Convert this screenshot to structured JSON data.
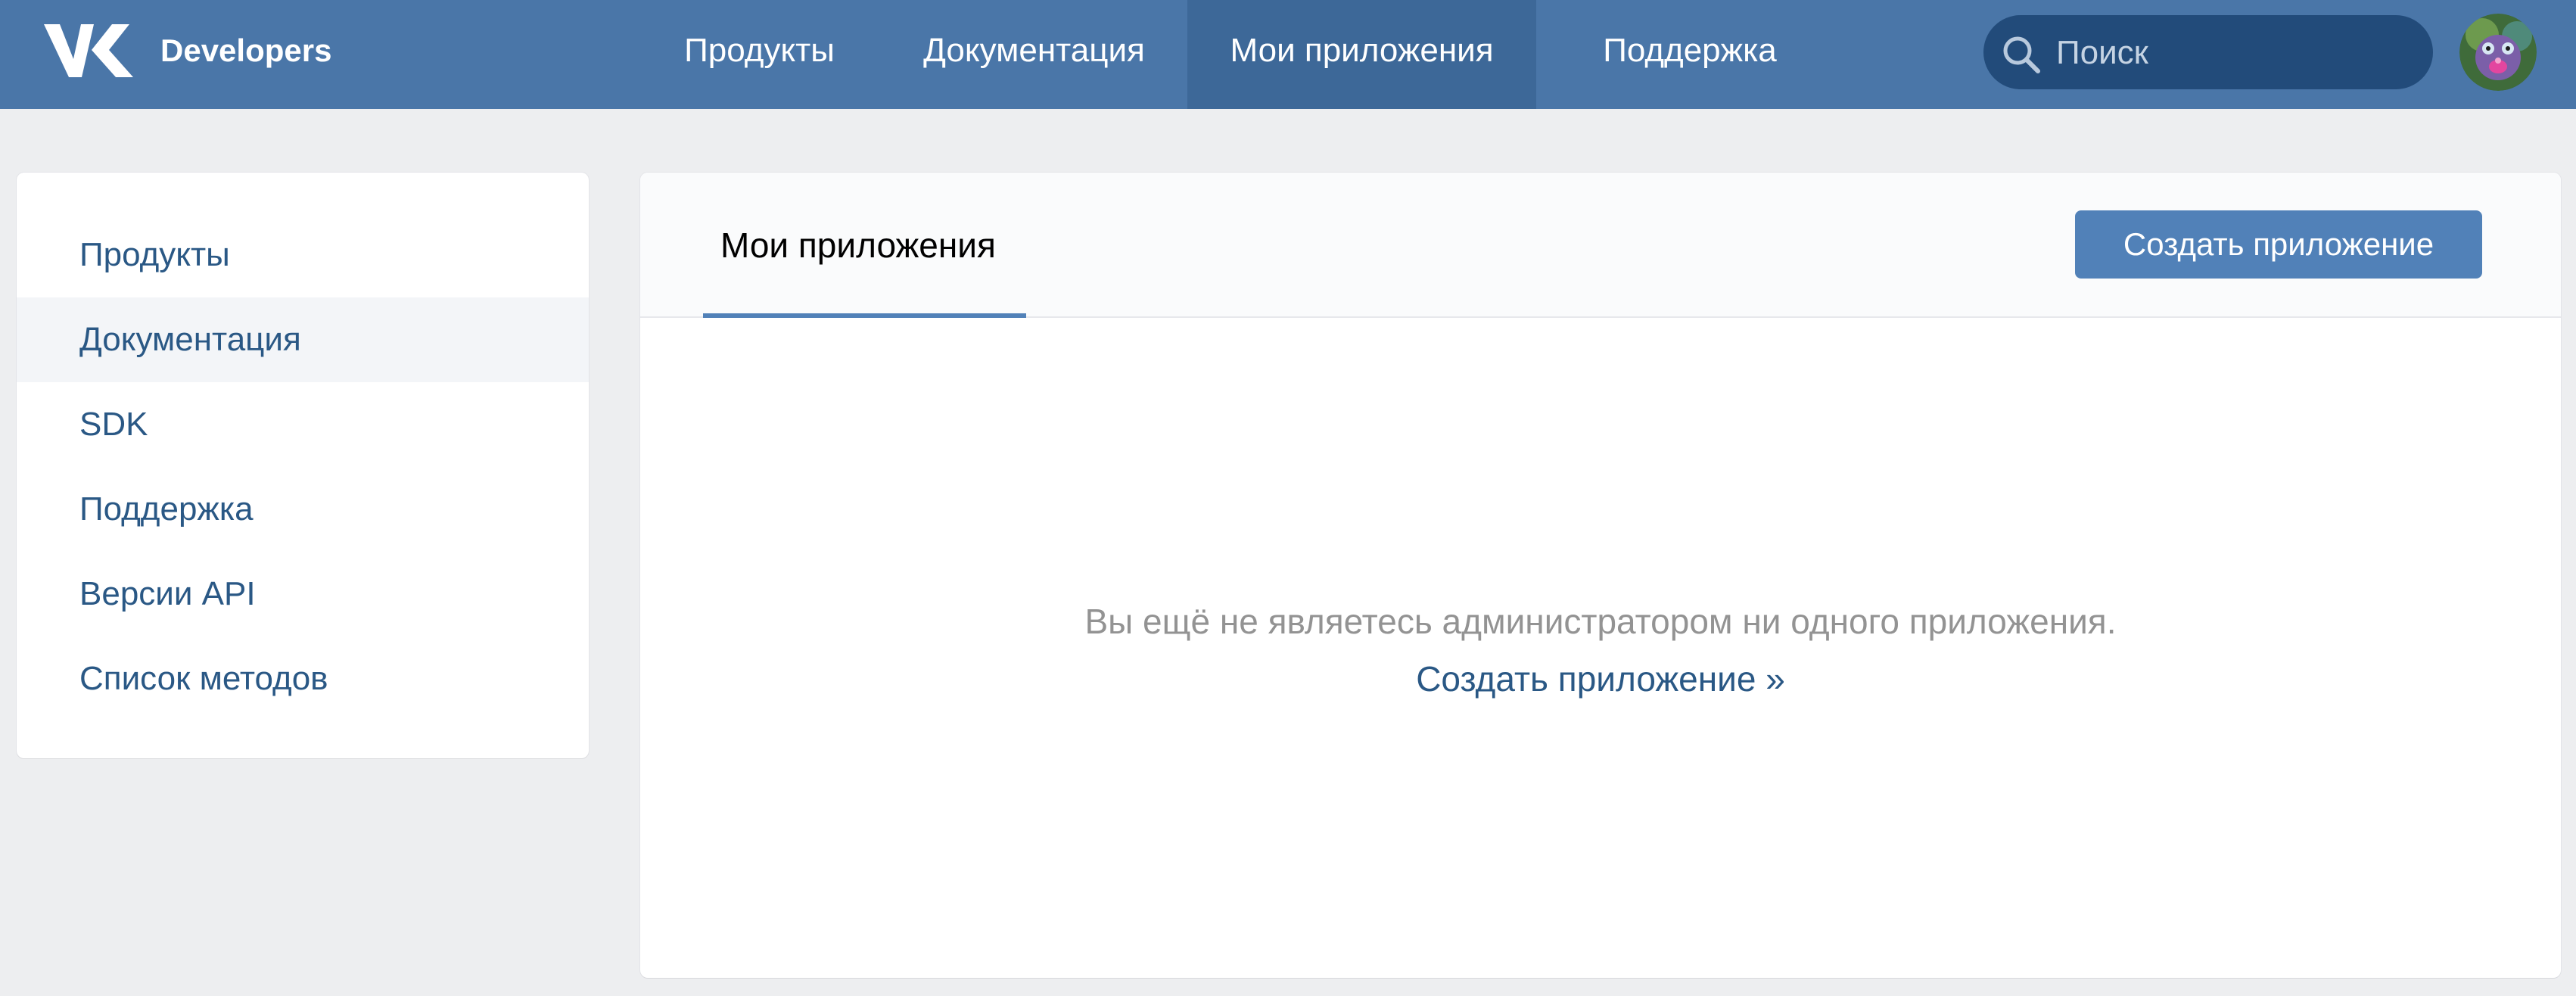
{
  "header": {
    "logo_icon": "vk-logo-icon",
    "brand": "Developers",
    "nav": [
      {
        "label": "Продукты",
        "active": false
      },
      {
        "label": "Документация",
        "active": false
      },
      {
        "label": "Мои приложения",
        "active": true
      },
      {
        "label": "Поддержка",
        "active": false
      }
    ],
    "search": {
      "placeholder": "Поиск",
      "value": "",
      "icon": "search-icon"
    },
    "avatar_icon": "user-avatar"
  },
  "sidebar": {
    "items": [
      {
        "label": "Продукты"
      },
      {
        "label": "Документация"
      },
      {
        "label": "SDK"
      },
      {
        "label": "Поддержка"
      },
      {
        "label": "Версии API"
      },
      {
        "label": "Список методов"
      }
    ]
  },
  "main": {
    "tab": "Мои приложения",
    "create_button": "Создать приложение",
    "empty_message": "Вы ещё не являетесь администратором ни одного приложения.",
    "create_link": "Создать приложение »"
  },
  "colors": {
    "header_bg": "#4a76a8",
    "header_active": "#3d6898",
    "search_bg": "#224b7a",
    "page_bg": "#edeef0",
    "link": "#2a5885",
    "button_bg": "#5181b8",
    "muted_text": "#939393"
  }
}
